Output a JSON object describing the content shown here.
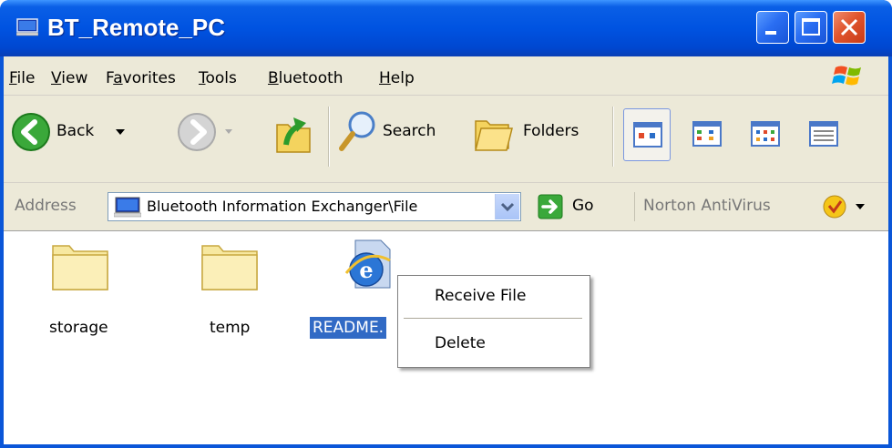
{
  "window": {
    "title": "BT_Remote_PC",
    "icon": "computer-icon",
    "controls": [
      "minimize-icon",
      "maximize-icon",
      "close-icon"
    ]
  },
  "menubar": {
    "items": [
      {
        "label": "File",
        "mnemonic": "F"
      },
      {
        "label": "View",
        "mnemonic": "V"
      },
      {
        "label": "Favorites",
        "mnemonic": "a"
      },
      {
        "label": "Tools",
        "mnemonic": "T"
      },
      {
        "label": "Bluetooth",
        "mnemonic": "B"
      },
      {
        "label": "Help",
        "mnemonic": "H"
      }
    ],
    "logo": "windows-logo"
  },
  "toolbar": {
    "back_label": "Back",
    "search_label": "Search",
    "folders_label": "Folders",
    "views": [
      "tiles-view-icon",
      "icons-view-icon",
      "list-view-icon",
      "details-view-icon"
    ]
  },
  "addressbar": {
    "label": "Address",
    "value": "Bluetooth Information Exchanger\\File",
    "go_label": "Go",
    "norton_label": "Norton AntiVirus"
  },
  "content": {
    "items": [
      {
        "name": "storage",
        "type": "folder",
        "selected": false
      },
      {
        "name": "temp",
        "type": "folder",
        "selected": false
      },
      {
        "name": "README.",
        "type": "ie-document",
        "selected": true
      }
    ]
  },
  "context_menu": {
    "items": [
      {
        "label": "Receive File"
      },
      {
        "label": "Delete"
      }
    ]
  },
  "colors": {
    "titlebar": "#0053e1",
    "selection": "#316ac5",
    "chrome": "#ece9d8"
  }
}
